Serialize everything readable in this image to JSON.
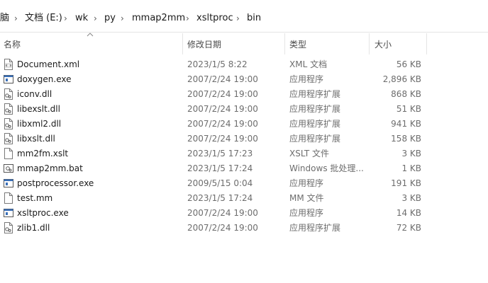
{
  "breadcrumb": {
    "items": [
      "脑",
      "文档 (E:)",
      "wk",
      "py",
      "mmap2mm",
      "xsltproc",
      "bin"
    ]
  },
  "columns": {
    "name": "名称",
    "date": "修改日期",
    "type": "类型",
    "size": "大小"
  },
  "files": [
    {
      "name": "Document.xml",
      "date": "2023/1/5 8:22",
      "type": "XML 文档",
      "size": "56 KB",
      "icon": "xml-file-icon"
    },
    {
      "name": "doxygen.exe",
      "date": "2007/2/24 19:00",
      "type": "应用程序",
      "size": "2,896 KB",
      "icon": "exe-file-icon"
    },
    {
      "name": "iconv.dll",
      "date": "2007/2/24 19:00",
      "type": "应用程序扩展",
      "size": "868 KB",
      "icon": "dll-file-icon"
    },
    {
      "name": "libexslt.dll",
      "date": "2007/2/24 19:00",
      "type": "应用程序扩展",
      "size": "51 KB",
      "icon": "dll-file-icon"
    },
    {
      "name": "libxml2.dll",
      "date": "2007/2/24 19:00",
      "type": "应用程序扩展",
      "size": "941 KB",
      "icon": "dll-file-icon"
    },
    {
      "name": "libxslt.dll",
      "date": "2007/2/24 19:00",
      "type": "应用程序扩展",
      "size": "158 KB",
      "icon": "dll-file-icon"
    },
    {
      "name": "mm2fm.xslt",
      "date": "2023/1/5 17:23",
      "type": "XSLT 文件",
      "size": "3 KB",
      "icon": "blank-file-icon"
    },
    {
      "name": "mmap2mm.bat",
      "date": "2023/1/5 17:24",
      "type": "Windows 批处理...",
      "size": "1 KB",
      "icon": "bat-file-icon"
    },
    {
      "name": "postprocessor.exe",
      "date": "2009/5/15 0:04",
      "type": "应用程序",
      "size": "191 KB",
      "icon": "exe-file-icon"
    },
    {
      "name": "test.mm",
      "date": "2023/1/5 17:24",
      "type": "MM 文件",
      "size": "3 KB",
      "icon": "blank-file-icon"
    },
    {
      "name": "xsltproc.exe",
      "date": "2007/2/24 19:00",
      "type": "应用程序",
      "size": "14 KB",
      "icon": "exe-file-icon"
    },
    {
      "name": "zlib1.dll",
      "date": "2007/2/24 19:00",
      "type": "应用程序扩展",
      "size": "72 KB",
      "icon": "dll-file-icon"
    }
  ]
}
